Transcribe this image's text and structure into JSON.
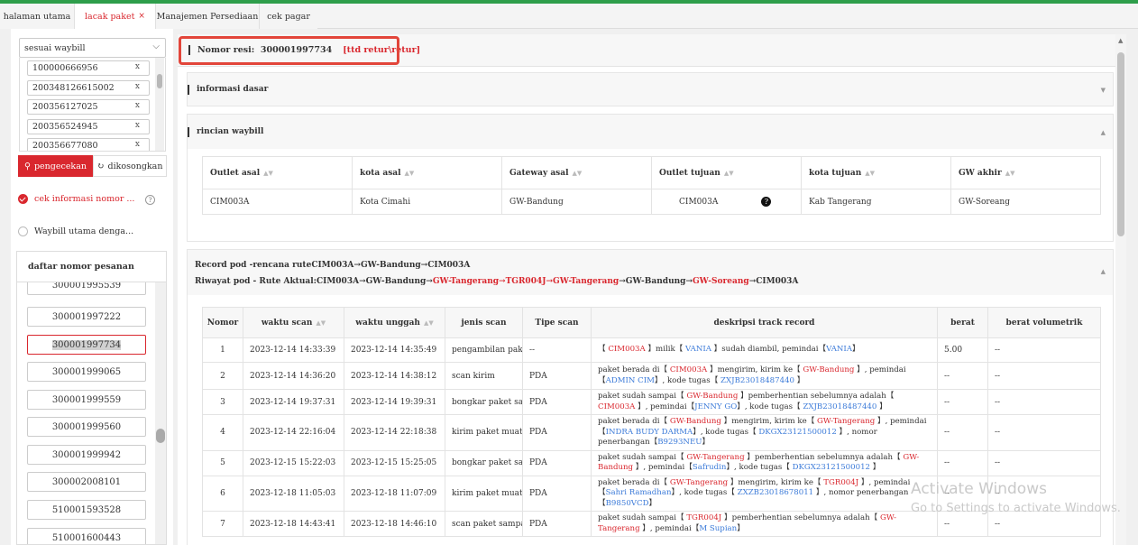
{
  "tabs": [
    {
      "label": "halaman utama",
      "active": false,
      "closable": false
    },
    {
      "label": "lacak paket",
      "active": true,
      "closable": true
    },
    {
      "label": "Manajemen Persediaan",
      "active": false,
      "closable": false
    },
    {
      "label": "cek pagar",
      "active": false,
      "closable": false
    }
  ],
  "sidebar": {
    "select_label": "sesuai waybill",
    "waybills": [
      "100000666956",
      "200348126615002",
      "200356127025",
      "200356524945",
      "200356677080"
    ],
    "search_button": "pengecekan",
    "clear_button": "dikosongkan",
    "option1": "cek informasi nomor ...",
    "option2": "Waybill utama denga...",
    "orders_title": "daftar nomor pesanan",
    "orders": [
      "300001995539",
      "300001997222",
      "300001997734",
      "300001999065",
      "300001999559",
      "300001999560",
      "300001999942",
      "300002008101",
      "510001593528",
      "510001600443"
    ]
  },
  "main": {
    "resi_label": "Nomor resi",
    "resi_number": "300001997734",
    "resi_tag": "[ttd retur\\retur]",
    "section_info": "informasi dasar",
    "section_waybill": "rincian waybill",
    "waybill_table": {
      "headers": [
        "Outlet asal",
        "kota asal",
        "Gateway asal",
        "Outlet tujuan",
        "kota tujuan",
        "GW akhir"
      ],
      "row": [
        "CIM003A",
        "Kota Cimahi",
        "GW-Bandung",
        "CIM003A",
        "Kab Tangerang",
        "GW-Soreang"
      ]
    },
    "record_plan": "Record pod -rencana ruteCIM003A→GW-Bandung→CIM003A",
    "route_prefix": "Riwayat pod - Rute Aktual:",
    "route": [
      {
        "t": "CIM003A",
        "c": "black"
      },
      {
        "t": "→GW-Bandung→",
        "c": "black"
      },
      {
        "t": "GW-Tangerang→TGR004J→GW-Tangerang",
        "c": "red"
      },
      {
        "t": "→GW-Bandung→",
        "c": "black"
      },
      {
        "t": "GW-Soreang",
        "c": "red"
      },
      {
        "t": "→CIM003A",
        "c": "black"
      }
    ],
    "track_headers": [
      "Nomor",
      "waktu scan",
      "waktu unggah",
      "jenis scan",
      "Tipe scan",
      "deskripsi track record",
      "berat",
      "berat volumetrik"
    ],
    "track_rows": [
      {
        "no": "1",
        "scan": "2023-12-14 14:33:39",
        "upload": "2023-12-14 14:35:49",
        "type": "pengambilan paket",
        "tipe": "--",
        "weight": "5.00",
        "vol": "--",
        "desc": [
          {
            "t": "【 ",
            "c": ""
          },
          {
            "t": "CIM003A",
            "c": "red"
          },
          {
            "t": " 】milik【 ",
            "c": ""
          },
          {
            "t": "VANIA",
            "c": "blue"
          },
          {
            "t": " 】sudah diambil,  pemindai【",
            "c": ""
          },
          {
            "t": "VANIA",
            "c": "blue"
          },
          {
            "t": "】",
            "c": ""
          }
        ]
      },
      {
        "no": "2",
        "scan": "2023-12-14 14:36:20",
        "upload": "2023-12-14 14:38:12",
        "type": "scan kirim",
        "tipe": "PDA",
        "weight": "--",
        "vol": "--",
        "desc": [
          {
            "t": "paket berada di【 ",
            "c": ""
          },
          {
            "t": "CIM003A",
            "c": "red"
          },
          {
            "t": " 】mengirim, kirim ke【 ",
            "c": ""
          },
          {
            "t": "GW-Bandung",
            "c": "red"
          },
          {
            "t": " 】,  pemindai【",
            "c": ""
          },
          {
            "t": "ADMIN CIM",
            "c": "blue"
          },
          {
            "t": "】,  kode tugas【 ",
            "c": ""
          },
          {
            "t": "ZXJB23018487440",
            "c": "blue"
          },
          {
            "t": " 】",
            "c": ""
          }
        ]
      },
      {
        "no": "3",
        "scan": "2023-12-14 19:37:31",
        "upload": "2023-12-14 19:39:31",
        "type": "bongkar paket sampai",
        "tipe": "PDA",
        "weight": "--",
        "vol": "--",
        "desc": [
          {
            "t": "paket sudah sampai【 ",
            "c": ""
          },
          {
            "t": "GW-Bandung",
            "c": "red"
          },
          {
            "t": " 】pemberhentian sebelumnya adalah【 ",
            "c": ""
          },
          {
            "t": "CIM003A",
            "c": "red"
          },
          {
            "t": " 】,  pemindai【",
            "c": ""
          },
          {
            "t": "JENNY GO",
            "c": "blue"
          },
          {
            "t": "】,  kode tugas【 ",
            "c": ""
          },
          {
            "t": "ZXJB23018487440",
            "c": "blue"
          },
          {
            "t": " 】",
            "c": ""
          }
        ]
      },
      {
        "no": "4",
        "scan": "2023-12-14 22:16:04",
        "upload": "2023-12-14 22:18:38",
        "type": "kirim paket muatan",
        "tipe": "PDA",
        "weight": "--",
        "vol": "--",
        "desc": [
          {
            "t": "paket berada di【 ",
            "c": ""
          },
          {
            "t": "GW-Bandung",
            "c": "red"
          },
          {
            "t": " 】mengirim, kirim ke【 ",
            "c": ""
          },
          {
            "t": "GW-Tangerang",
            "c": "red"
          },
          {
            "t": " 】,  pemindai【",
            "c": ""
          },
          {
            "t": "INDRA BUDY DARMA",
            "c": "blue"
          },
          {
            "t": "】,  kode tugas【 ",
            "c": ""
          },
          {
            "t": "DKGX23121500012",
            "c": "blue"
          },
          {
            "t": " 】,  nomor penerbangan【",
            "c": ""
          },
          {
            "t": "B9293NEU",
            "c": "blue"
          },
          {
            "t": "】",
            "c": ""
          }
        ]
      },
      {
        "no": "5",
        "scan": "2023-12-15 15:22:03",
        "upload": "2023-12-15 15:25:05",
        "type": "bongkar paket sampai",
        "tipe": "PDA",
        "weight": "--",
        "vol": "--",
        "desc": [
          {
            "t": "paket sudah sampai【 ",
            "c": ""
          },
          {
            "t": "GW-Tangerang",
            "c": "red"
          },
          {
            "t": " 】pemberhentian sebelumnya adalah【 ",
            "c": ""
          },
          {
            "t": "GW-Bandung",
            "c": "red"
          },
          {
            "t": " 】,  pemindai【",
            "c": ""
          },
          {
            "t": "Safrudin",
            "c": "blue"
          },
          {
            "t": "】,  kode tugas【 ",
            "c": ""
          },
          {
            "t": "DKGX23121500012",
            "c": "blue"
          },
          {
            "t": " 】",
            "c": ""
          }
        ]
      },
      {
        "no": "6",
        "scan": "2023-12-18 11:05:03",
        "upload": "2023-12-18 11:07:09",
        "type": "kirim paket muatan",
        "tipe": "PDA",
        "weight": "--",
        "vol": "--",
        "desc": [
          {
            "t": "paket berada di【 ",
            "c": ""
          },
          {
            "t": "GW-Tangerang",
            "c": "red"
          },
          {
            "t": " 】mengirim, kirim ke【 ",
            "c": ""
          },
          {
            "t": "TGR004J",
            "c": "red"
          },
          {
            "t": " 】,  pemindai【",
            "c": ""
          },
          {
            "t": "Sahri Ramadhan",
            "c": "blue"
          },
          {
            "t": "】,  kode tugas【 ",
            "c": ""
          },
          {
            "t": "ZXZB23018678011",
            "c": "blue"
          },
          {
            "t": " 】,  nomor penerbangan【",
            "c": ""
          },
          {
            "t": "B9850VCD",
            "c": "blue"
          },
          {
            "t": "】",
            "c": ""
          }
        ]
      },
      {
        "no": "7",
        "scan": "2023-12-18 14:43:41",
        "upload": "2023-12-18 14:46:10",
        "type": "scan paket sampai",
        "tipe": "PDA",
        "weight": "--",
        "vol": "--",
        "desc": [
          {
            "t": "paket sudah sampai【 ",
            "c": ""
          },
          {
            "t": "TGR004J",
            "c": "red"
          },
          {
            "t": " 】pemberhentian sebelumnya adalah【 ",
            "c": ""
          },
          {
            "t": "GW-Tangerang",
            "c": "red"
          },
          {
            "t": " 】,  pemindai【",
            "c": ""
          },
          {
            "t": "M Supian",
            "c": "blue"
          },
          {
            "t": "】",
            "c": ""
          }
        ]
      }
    ]
  },
  "os_watermark": {
    "line1": "Activate Windows",
    "line2": "Go to Settings to activate Windows."
  }
}
